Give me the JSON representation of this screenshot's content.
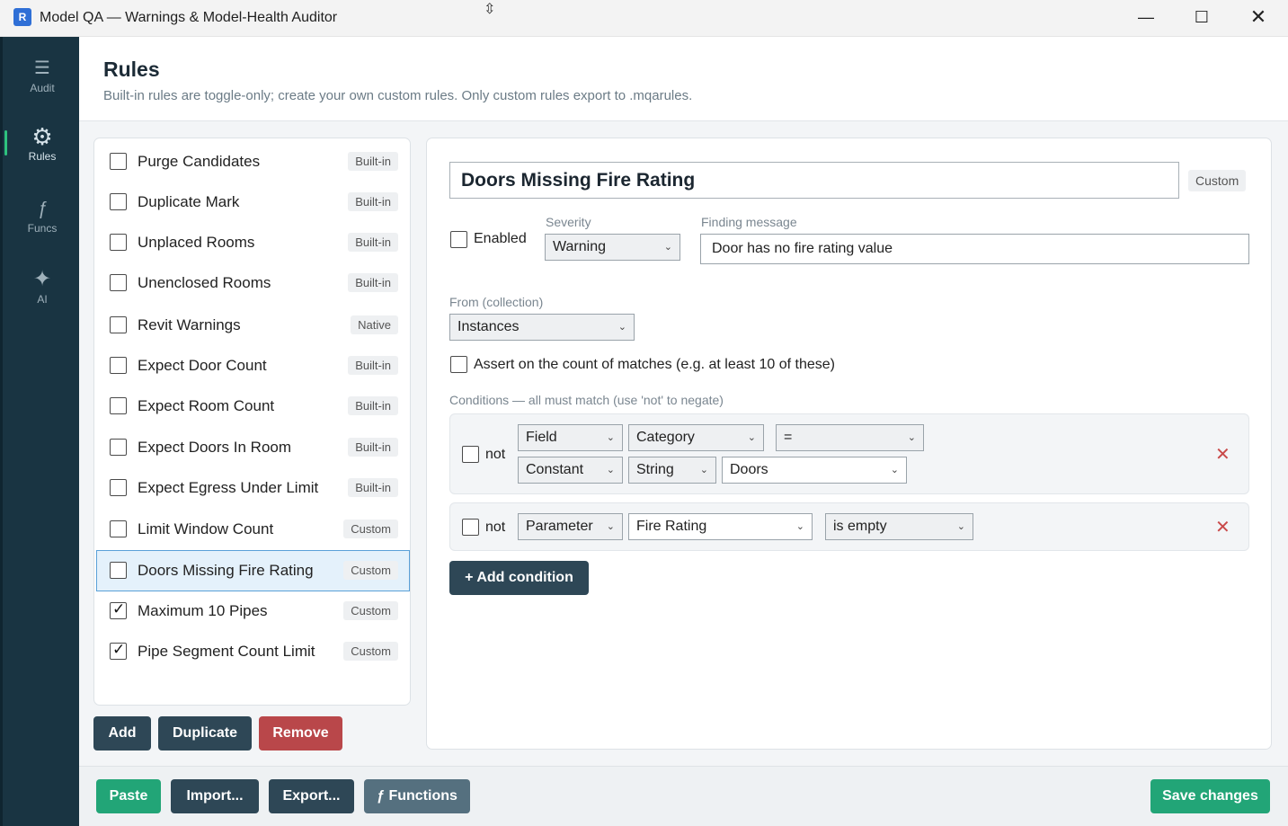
{
  "window": {
    "title": "Model QA — Warnings & Model-Health Auditor",
    "app_icon_letter": "R",
    "minimize_glyph": "—",
    "maximize_glyph": "☐",
    "close_glyph": "✕",
    "cursor_glyph": "⇳"
  },
  "sidebar": {
    "items": [
      {
        "label": "Audit",
        "icon": "menu-icon",
        "glyph": "☰",
        "active": false
      },
      {
        "label": "Rules",
        "icon": "gear-icon",
        "glyph": "⚙",
        "active": true
      },
      {
        "label": "Funcs",
        "icon": "function-icon",
        "glyph": "ƒ",
        "active": false
      },
      {
        "label": "AI",
        "icon": "sparkle-icon",
        "glyph": "✦",
        "active": false
      }
    ]
  },
  "header": {
    "title": "Rules",
    "subtitle": "Built-in rules are toggle-only; create your own custom rules. Only custom rules export to .mqarules."
  },
  "rules": [
    {
      "label": "Purge Candidates",
      "tag": "Built-in",
      "checked": false,
      "selected": false
    },
    {
      "label": "Duplicate Mark",
      "tag": "Built-in",
      "checked": false,
      "selected": false
    },
    {
      "label": "Unplaced Rooms",
      "tag": "Built-in",
      "checked": false,
      "selected": false
    },
    {
      "label": "Unenclosed Rooms",
      "tag": "Built-in",
      "checked": false,
      "selected": false
    },
    {
      "label": "Revit Warnings",
      "tag": "Native",
      "checked": false,
      "selected": false
    },
    {
      "label": "Expect Door Count",
      "tag": "Built-in",
      "checked": false,
      "selected": false
    },
    {
      "label": "Expect Room Count",
      "tag": "Built-in",
      "checked": false,
      "selected": false
    },
    {
      "label": "Expect Doors In Room",
      "tag": "Built-in",
      "checked": false,
      "selected": false
    },
    {
      "label": "Expect Egress Under Limit",
      "tag": "Built-in",
      "checked": false,
      "selected": false
    },
    {
      "label": "Limit Window Count",
      "tag": "Custom",
      "checked": false,
      "selected": false
    },
    {
      "label": "Doors Missing Fire Rating",
      "tag": "Custom",
      "checked": false,
      "selected": true
    },
    {
      "label": "Maximum 10 Pipes",
      "tag": "Custom",
      "checked": true,
      "selected": false
    },
    {
      "label": "Pipe Segment Count Limit",
      "tag": "Custom",
      "checked": true,
      "selected": false
    }
  ],
  "list_buttons": {
    "add": "Add",
    "duplicate": "Duplicate",
    "remove": "Remove"
  },
  "editor": {
    "name": "Doors Missing Fire Rating",
    "type_tag": "Custom",
    "enabled_label": "Enabled",
    "enabled": false,
    "severity_caption": "Severity",
    "severity_value": "Warning",
    "message_caption": "Finding message",
    "message_value": "Door has no fire rating value",
    "from_caption": "From (collection)",
    "from_value": "Instances",
    "assert_label": "Assert on the count of matches (e.g. at least 10 of these)",
    "assert_checked": false,
    "conditions_caption": "Conditions — all must match (use 'not' to negate)",
    "not_label": "not",
    "condition1": {
      "left_kind": "Field",
      "left_value": "Category",
      "operator": "=",
      "right_kind": "Constant",
      "right_type": "String",
      "right_value": "Doors"
    },
    "condition2": {
      "kind": "Parameter",
      "param": "Fire Rating",
      "operator": "is empty"
    },
    "remove_glyph": "✕",
    "chevron_glyph": "⌄",
    "add_condition": "+ Add condition"
  },
  "footer": {
    "paste": "Paste",
    "import": "Import...",
    "export": "Export...",
    "functions": "ƒ Functions",
    "save": "Save changes"
  },
  "colors": {
    "sidebar_bg": "#193442",
    "accent_green": "#22a577",
    "danger_red": "#b9474a",
    "button_dark": "#2e4756",
    "selected_row": "#e4f1fb"
  }
}
